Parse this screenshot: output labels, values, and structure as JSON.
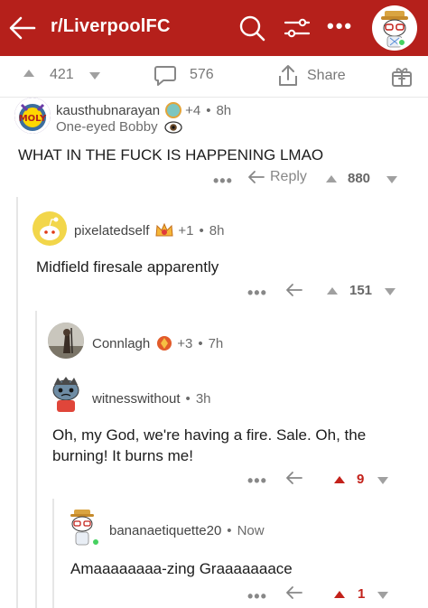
{
  "header": {
    "subreddit": "r/LiverpoolFC",
    "bg_color": "#b5201b"
  },
  "post_bar": {
    "upvotes": "421",
    "comments": "576",
    "share_label": "Share"
  },
  "comments": [
    {
      "username": "kausthubnarayan",
      "awards": "+4",
      "time": "8h",
      "flair": "One-eyed Bobby",
      "body": "WHAT IN THE FUCK IS HAPPENING LMAO",
      "reply_label": "Reply",
      "votes": "880"
    },
    {
      "username": "pixelatedself",
      "awards": "+1",
      "time": "8h",
      "body": "Midfield firesale apparently",
      "votes": "151"
    },
    {
      "username": "Connlagh",
      "awards": "+3",
      "time": "7h"
    },
    {
      "username": "witnesswithout",
      "time": "3h",
      "body": "Oh, my God, we're having a fire. Sale. Oh, the burning! It burns me!",
      "votes": "9"
    },
    {
      "username": "bananaetiquette20",
      "time": "Now",
      "body": "Amaaaaaaaa-zing Graaaaaaace",
      "votes": "1"
    }
  ],
  "colors": {
    "accent": "#b5201b",
    "upvoted": "#c3211a",
    "meta_text": "#6b6b6b"
  }
}
